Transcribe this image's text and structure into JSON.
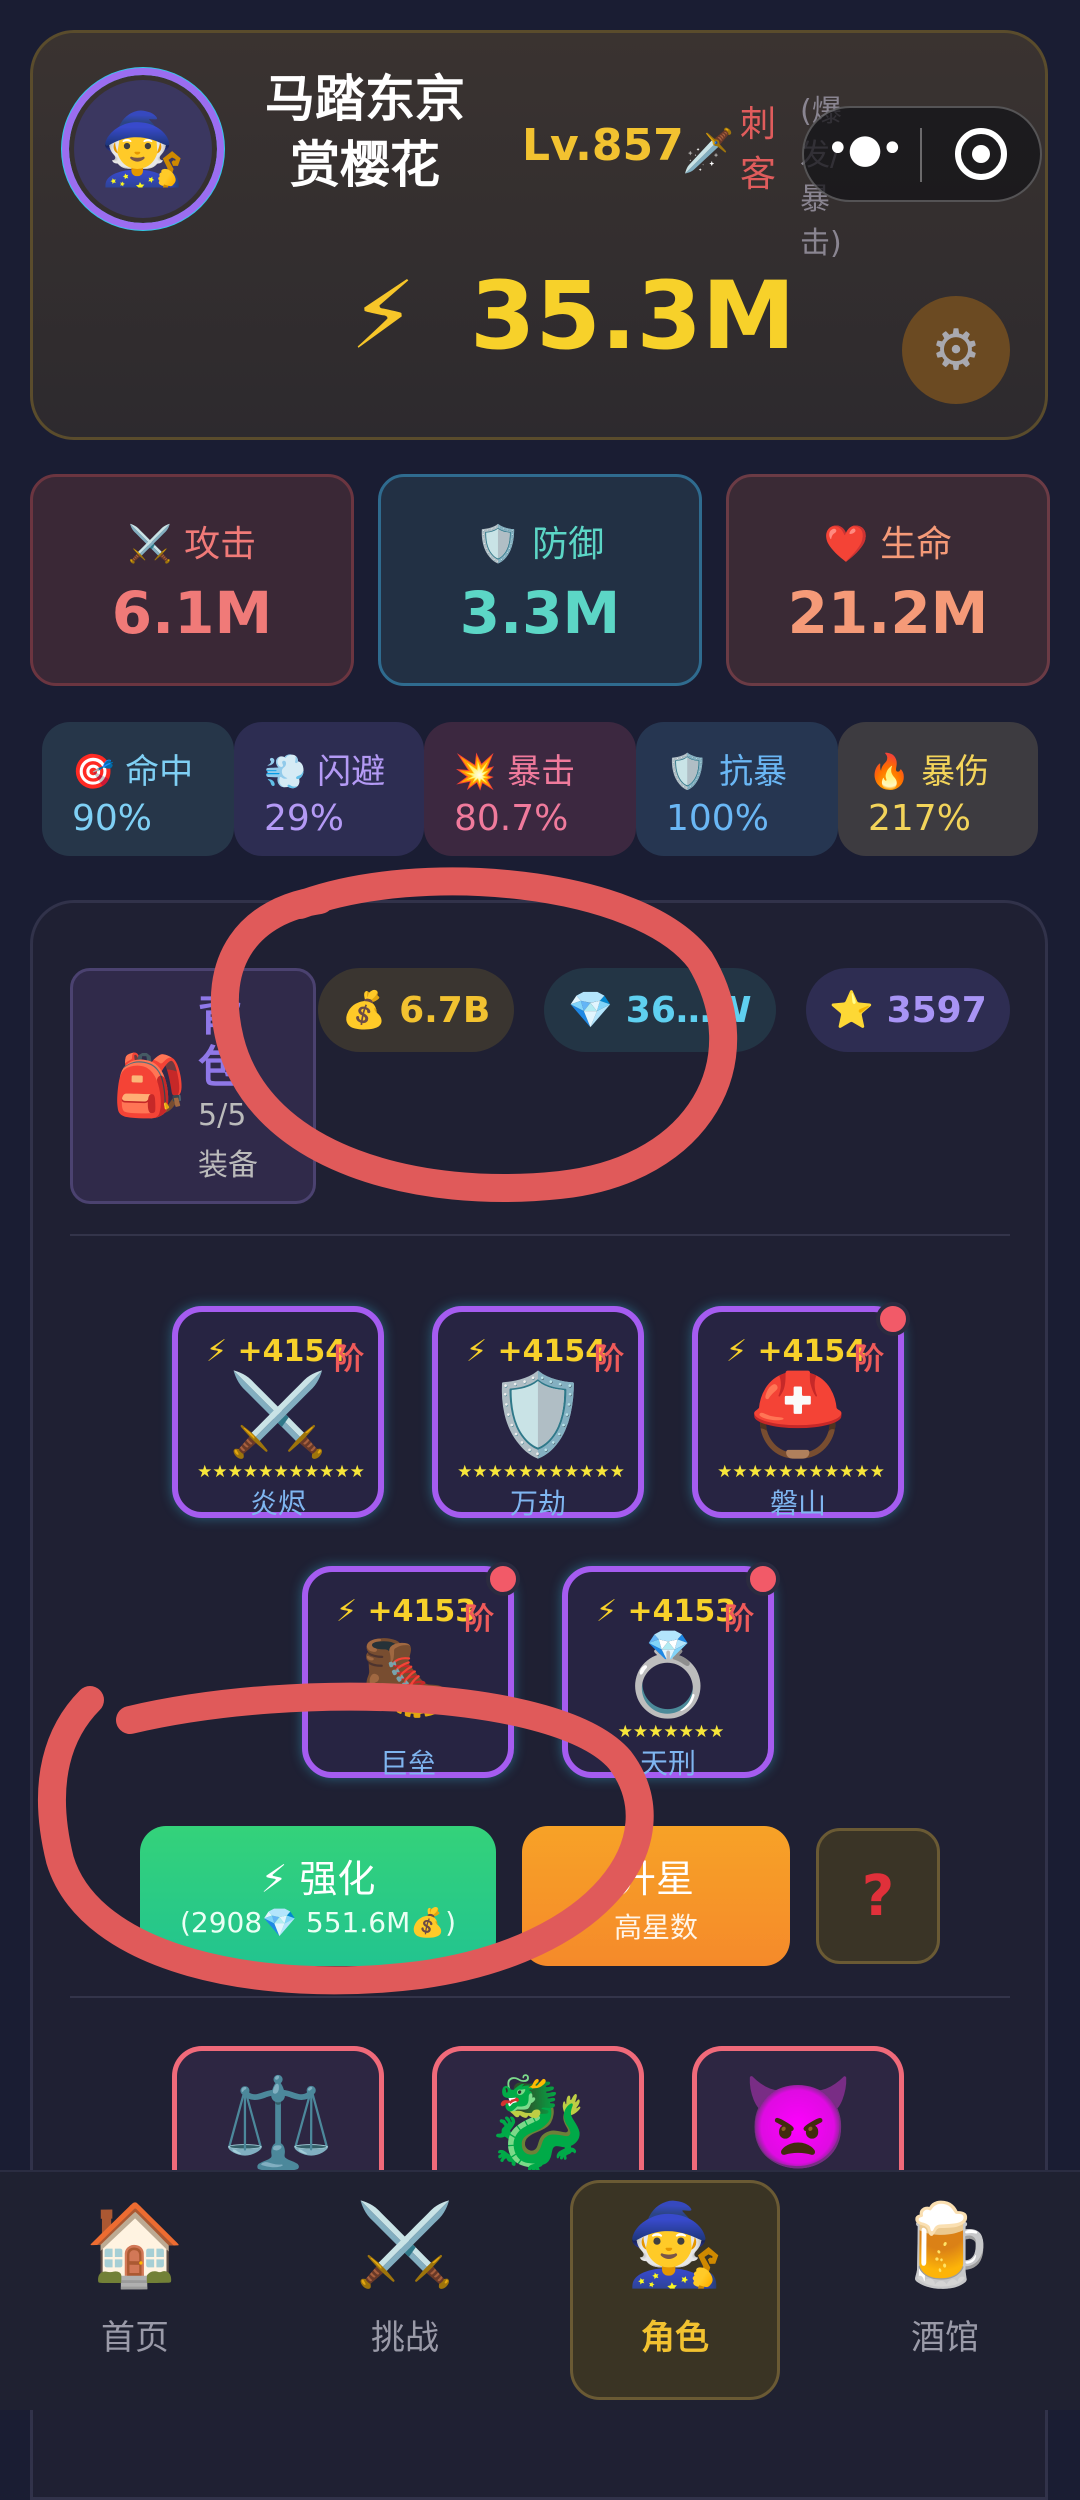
{
  "player": {
    "name": "马踏东京赏樱花",
    "name_line1": "马踏东京",
    "name_line2": "赏樱花",
    "level": "Lv.857",
    "class_label": "刺客",
    "class_suffix": "(爆发/暴击)",
    "power": "35.3M",
    "avatar_icon": "wizard-icon"
  },
  "stats": {
    "attack": {
      "label": "攻击",
      "value": "6.1M",
      "icon": "⚔️"
    },
    "defense": {
      "label": "防御",
      "value": "3.3M",
      "icon": "🛡️"
    },
    "health": {
      "label": "生命",
      "value": "21.2M",
      "icon": "❤️"
    }
  },
  "sub_stats": [
    {
      "label": "命中",
      "value": "90%",
      "icon": "🎯"
    },
    {
      "label": "闪避",
      "value": "29%",
      "icon": "💨"
    },
    {
      "label": "暴击",
      "value": "80.7%",
      "icon": "💥"
    },
    {
      "label": "抗暴",
      "value": "100%",
      "icon": "🛡️"
    },
    {
      "label": "暴伤",
      "value": "217%",
      "icon": "🔥"
    }
  ],
  "backpack": {
    "title": "背包",
    "count": "5/5",
    "subtitle": "装备"
  },
  "currency": {
    "gold": "6.7B",
    "diamond": "36…W",
    "stars": "3597"
  },
  "equipment": [
    {
      "power": "+4154",
      "tier": "阶",
      "name": "炎烬",
      "icon": "⚔️",
      "stars": "★★★★★★★★★★★",
      "notify": false
    },
    {
      "power": "+4154",
      "tier": "阶",
      "name": "万劫",
      "icon": "🛡️",
      "stars": "★★★★★★★★★★★",
      "notify": false
    },
    {
      "power": "+4154",
      "tier": "阶",
      "name": "磐山",
      "icon": "⛑️",
      "stars": "★★★★★★★★★★★",
      "notify": true
    },
    {
      "power": "+4153",
      "tier": "阶",
      "name": "巨垒",
      "icon": "🥾",
      "stars": "",
      "notify": true
    },
    {
      "power": "+4153",
      "tier": "阶",
      "name": "天刑",
      "icon": "💍",
      "stars": "★★★★★★★",
      "notify": true
    }
  ],
  "actions": {
    "strengthen_label": "强化",
    "strengthen_cost": "(2908💎 551.6M💰)",
    "upstar_label": "升星",
    "upstar_sub": "高星数",
    "help_label": "?"
  },
  "relics": [
    {
      "icon": "⚖️"
    },
    {
      "icon": "🐉"
    },
    {
      "icon": "👿"
    }
  ],
  "nav": {
    "home": "首页",
    "challenge": "挑战",
    "character": "角色",
    "tavern": "酒馆"
  },
  "colors": {
    "background": "#1a1d33",
    "power_yellow": "#f7d12a",
    "annotation_red": "#e05a5a"
  }
}
